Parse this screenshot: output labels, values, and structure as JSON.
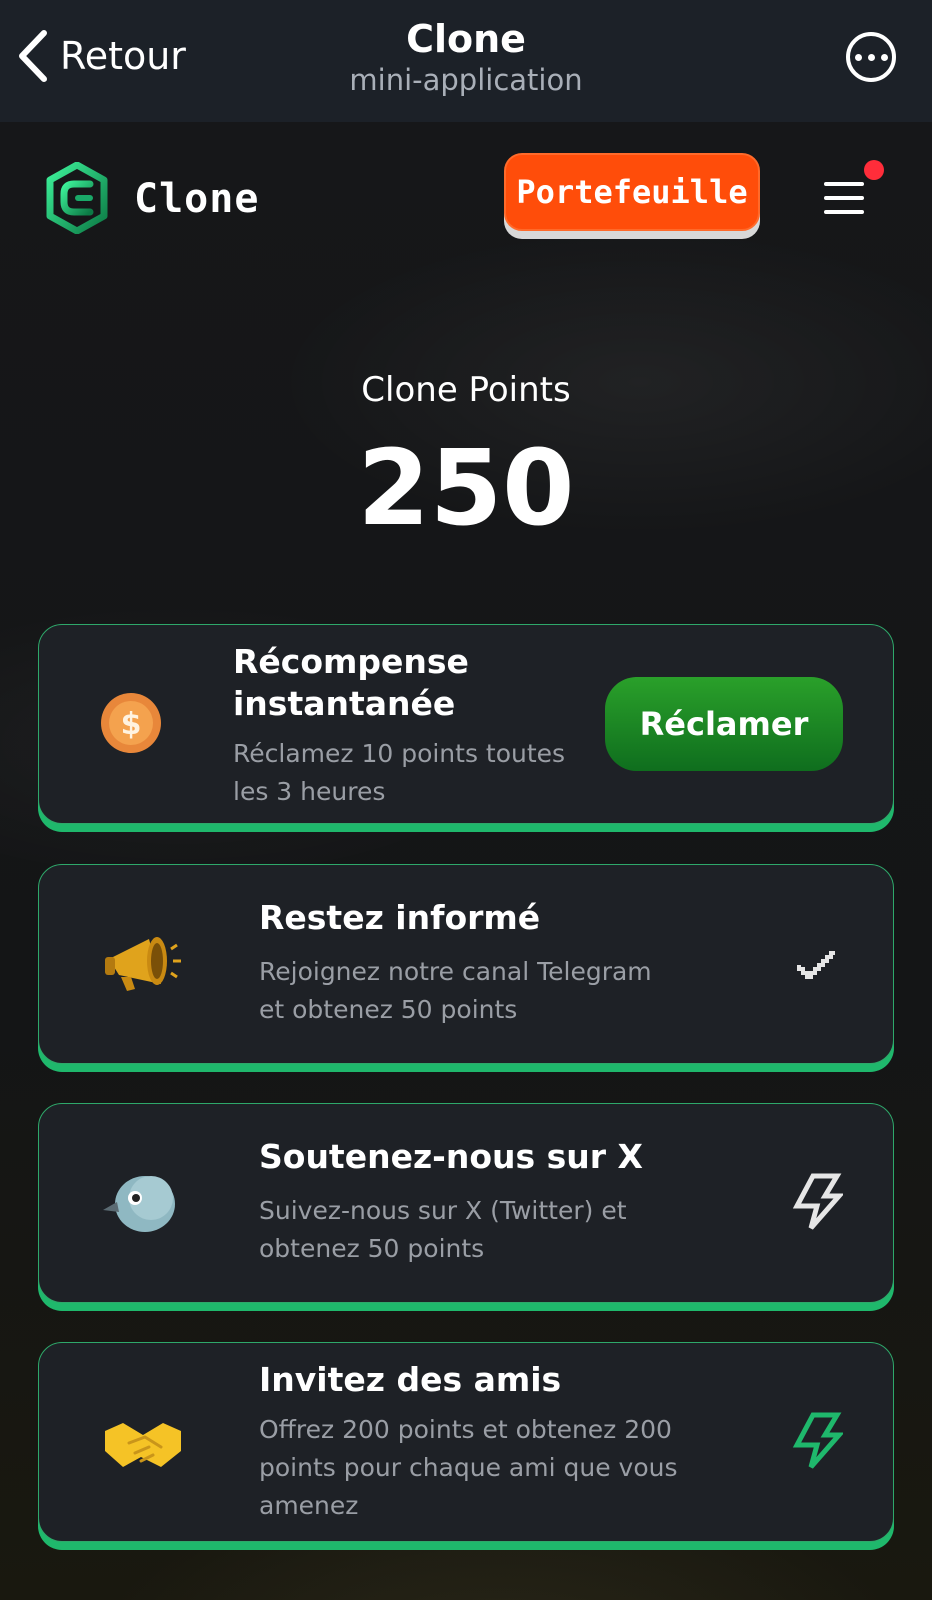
{
  "topbar": {
    "back_label": "Retour",
    "title": "Clone",
    "subtitle": "mini-application"
  },
  "header": {
    "brand": "Clone",
    "wallet_label": "Portefeuille",
    "notification_color": "#ff2d3a"
  },
  "points": {
    "label": "Clone Points",
    "value": "250"
  },
  "tasks": [
    {
      "icon": "coin-icon",
      "title": "Récompense instantanée",
      "description": "Réclamez 10 points toutes les 3 heures",
      "action_label": "Réclamer"
    },
    {
      "icon": "megaphone-icon",
      "title": "Restez informé",
      "description": "Rejoignez notre canal Telegram et obtenez 50 points",
      "status": "check-icon"
    },
    {
      "icon": "bird-icon",
      "title": "Soutenez-nous sur X",
      "description": "Suivez-nous sur X (Twitter) et obtenez 50 points",
      "status": "lightning-icon"
    },
    {
      "icon": "handshake-icon",
      "title": "Invitez des amis",
      "description": "Offrez 200 points et obtenez 200 points pour chaque ami que vous amenez",
      "status": "lightning-icon"
    }
  ],
  "colors": {
    "accent_green": "#1fb86c",
    "wallet_orange": "#ff4d0a",
    "claim_green": "#2aa02a"
  }
}
